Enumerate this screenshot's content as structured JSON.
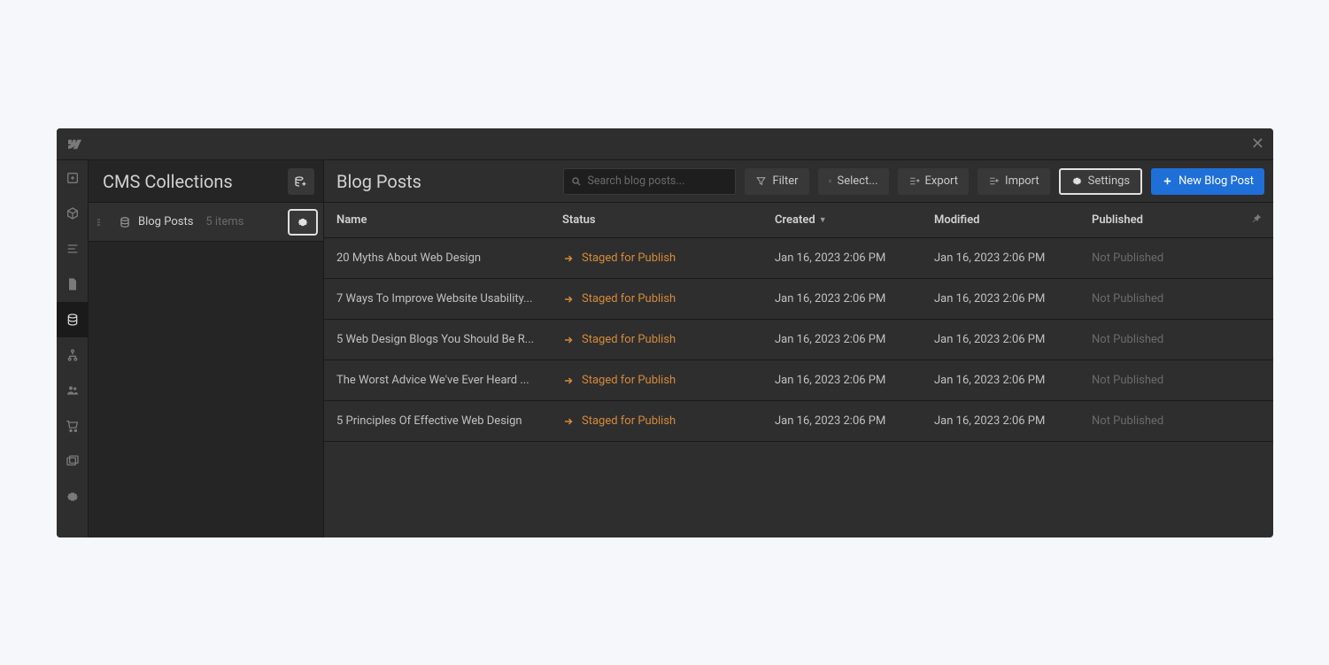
{
  "sidebar": {
    "title": "CMS Collections",
    "collection": {
      "name": "Blog Posts",
      "count": "5 items"
    }
  },
  "toolbar": {
    "title": "Blog Posts",
    "search_placeholder": "Search blog posts...",
    "filter": "Filter",
    "select": "Select...",
    "export": "Export",
    "import": "Import",
    "settings": "Settings",
    "new": "New Blog Post"
  },
  "columns": {
    "name": "Name",
    "status": "Status",
    "created": "Created",
    "modified": "Modified",
    "published": "Published"
  },
  "rows": [
    {
      "name": "20 Myths About Web Design",
      "status": "Staged for Publish",
      "created": "Jan 16, 2023 2:06 PM",
      "modified": "Jan 16, 2023 2:06 PM",
      "published": "Not Published"
    },
    {
      "name": "7 Ways To Improve Website Usability...",
      "status": "Staged for Publish",
      "created": "Jan 16, 2023 2:06 PM",
      "modified": "Jan 16, 2023 2:06 PM",
      "published": "Not Published"
    },
    {
      "name": "5 Web Design Blogs You Should Be R...",
      "status": "Staged for Publish",
      "created": "Jan 16, 2023 2:06 PM",
      "modified": "Jan 16, 2023 2:06 PM",
      "published": "Not Published"
    },
    {
      "name": "The Worst Advice We've Ever Heard ...",
      "status": "Staged for Publish",
      "created": "Jan 16, 2023 2:06 PM",
      "modified": "Jan 16, 2023 2:06 PM",
      "published": "Not Published"
    },
    {
      "name": "5 Principles Of Effective Web Design",
      "status": "Staged for Publish",
      "created": "Jan 16, 2023 2:06 PM",
      "modified": "Jan 16, 2023 2:06 PM",
      "published": "Not Published"
    }
  ]
}
